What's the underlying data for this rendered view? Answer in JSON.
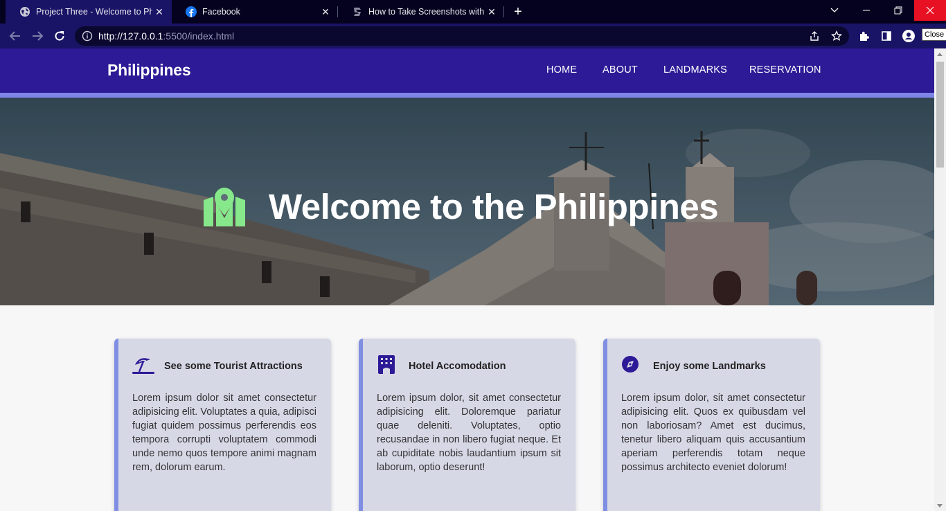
{
  "browser": {
    "tabs": [
      {
        "title": "Project Three - Welcome to Philippines",
        "close": "✕"
      },
      {
        "title": "Facebook",
        "close": "✕"
      },
      {
        "title": "How to Take Screenshots with Dell",
        "close": "✕"
      }
    ],
    "new_tab_label": "+",
    "url_host": "http://127.0.0.1",
    "url_rest": ":5500/index.html",
    "tooltip": "Close",
    "window_controls": {
      "dropdown": "⌄",
      "minimize": "—",
      "restore": "❐",
      "close": "✕"
    }
  },
  "site": {
    "brand": "Philippines",
    "menu": [
      "HOME",
      "ABOUT",
      "LANDMARKS",
      "RESERVATION"
    ],
    "hero_title": "Welcome to the Philippines",
    "cards": [
      {
        "icon": "beach-umbrella-icon",
        "title": "See some Tourist Attractions",
        "text": "Lorem ipsum dolor sit amet consectetur adipisicing elit. Voluptates a quia, adipisci fugiat quidem possimus perferendis eos tempora corrupti voluptatem commodi unde nemo quos tempore animi magnam rem, dolorum earum."
      },
      {
        "icon": "hotel-building-icon",
        "title": "Hotel Accomodation",
        "text": "Lorem ipsum dolor, sit amet consectetur adipisicing elit. Doloremque pariatur quae deleniti. Voluptates, optio recusandae in non libero fugiat neque. Et ab cupiditate nobis laudantium ipsum sit laborum, optio deserunt!"
      },
      {
        "icon": "compass-icon",
        "title": "Enjoy some Landmarks",
        "text": "Lorem ipsum dolor, sit amet consectetur adipisicing elit. Quos ex quibusdam vel non laboriosam? Amet est ducimus, tenetur libero aliquam quis accusantium aperiam perferendis totam neque possimus architecto eveniet dolorum!"
      }
    ]
  },
  "colors": {
    "nav_bg": "#2d1a96",
    "accent": "#7f85e6",
    "card_bg": "#d7d8e6",
    "hero_icon": "#86e88a"
  }
}
